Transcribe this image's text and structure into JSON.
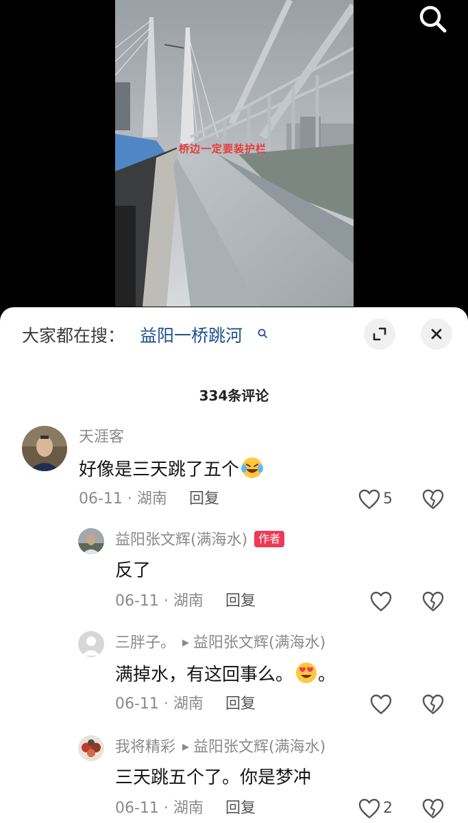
{
  "video": {
    "overlay_caption": "桥边一定要装护栏"
  },
  "sheet": {
    "trending_label": "大家都在搜：",
    "trending_query": "益阳一桥跳河",
    "comment_count": "334条评论"
  },
  "comments": [
    {
      "username": "天涯客",
      "text": "好像是三天跳了五个",
      "emoji": "laughing-crying-emoji",
      "date_location": "06-11 · 湖南",
      "reply_label": "回复",
      "likes": "5"
    },
    {
      "username": "益阳张文辉(满海水)",
      "badge": "作者",
      "text": "反了",
      "date_location": "06-11 · 湖南",
      "reply_label": "回复"
    },
    {
      "username": "三胖子。",
      "reply_to": "益阳张文辉(满海水)",
      "text": "满掉水，有这回事么。",
      "text_suffix": "。",
      "emoji": "heart-eyes-emoji",
      "date_location": "06-11 · 湖南",
      "reply_label": "回复"
    },
    {
      "username": "我将精彩",
      "reply_to": "益阳张文辉(满海水)",
      "text": "三天跳五个了。你是梦冲",
      "date_location": "06-11 · 湖南",
      "reply_label": "回复",
      "likes": "2"
    }
  ],
  "colors": {
    "link_blue": "#1e4f8f",
    "author_badge": "#ee3a55",
    "meta_gray": "#8a8a8a"
  }
}
